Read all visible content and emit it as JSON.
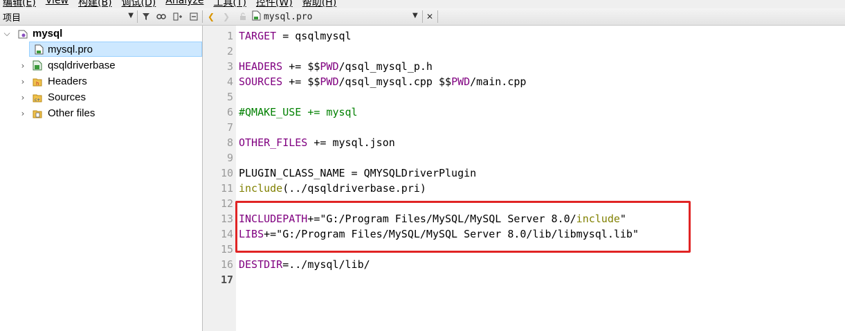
{
  "menubar": {
    "items": [
      "编辑(E)",
      "View",
      "构建(B)",
      "调试(D)",
      "Analyze",
      "工具(T)",
      "控件(W)",
      "帮助(H)"
    ]
  },
  "toolbar": {
    "project_combo_label": "项目",
    "open_file_name": "mysql.pro"
  },
  "tree": {
    "root": {
      "label": "mysql",
      "expanded": true
    },
    "items": [
      {
        "label": "mysql.pro",
        "selected": true
      },
      {
        "label": "qsqldriverbase",
        "expandable": true
      },
      {
        "label": "Headers",
        "expandable": true
      },
      {
        "label": "Sources",
        "expandable": true
      },
      {
        "label": "Other files",
        "expandable": true
      }
    ]
  },
  "editor": {
    "current_line": 17,
    "lines": [
      {
        "n": "1",
        "segments": [
          [
            "TARGET",
            "var"
          ],
          [
            " = qsqlmysql",
            "def"
          ]
        ]
      },
      {
        "n": "2",
        "segments": []
      },
      {
        "n": "3",
        "segments": [
          [
            "HEADERS",
            "var"
          ],
          [
            " += $$",
            "def"
          ],
          [
            "PWD",
            "var"
          ],
          [
            "/qsql_mysql_p.h",
            "def"
          ]
        ]
      },
      {
        "n": "4",
        "segments": [
          [
            "SOURCES",
            "var"
          ],
          [
            " += $$",
            "def"
          ],
          [
            "PWD",
            "var"
          ],
          [
            "/qsql_mysql.cpp $$",
            "def"
          ],
          [
            "PWD",
            "var"
          ],
          [
            "/main.cpp",
            "def"
          ]
        ]
      },
      {
        "n": "5",
        "segments": []
      },
      {
        "n": "6",
        "segments": [
          [
            "#QMAKE_USE += mysql",
            "cmt"
          ]
        ]
      },
      {
        "n": "7",
        "segments": []
      },
      {
        "n": "8",
        "segments": [
          [
            "OTHER_FILES",
            "var"
          ],
          [
            " += mysql.json",
            "def"
          ]
        ]
      },
      {
        "n": "9",
        "segments": []
      },
      {
        "n": "10",
        "segments": [
          [
            "PLUGIN_CLASS_NAME = QMYSQLDriverPlugin",
            "def"
          ]
        ]
      },
      {
        "n": "11",
        "segments": [
          [
            "include",
            "kw"
          ],
          [
            "(../qsqldriverbase.pri)",
            "def"
          ]
        ]
      },
      {
        "n": "12",
        "segments": []
      },
      {
        "n": "13",
        "segments": [
          [
            "INCLUDEPATH",
            "var"
          ],
          [
            "+=\"G:/Program Files/MySQL/MySQL Server 8.0/",
            "def"
          ],
          [
            "include",
            "kw"
          ],
          [
            "\"",
            "def"
          ]
        ]
      },
      {
        "n": "14",
        "segments": [
          [
            "LIBS",
            "var"
          ],
          [
            "+=\"G:/Program Files/MySQL/MySQL Server 8.0/lib/libmysql.lib\"",
            "def"
          ]
        ]
      },
      {
        "n": "15",
        "segments": []
      },
      {
        "n": "16",
        "segments": [
          [
            "DESTDIR",
            "var"
          ],
          [
            "=../mysql/lib/",
            "def"
          ]
        ]
      },
      {
        "n": "17",
        "segments": []
      }
    ]
  }
}
